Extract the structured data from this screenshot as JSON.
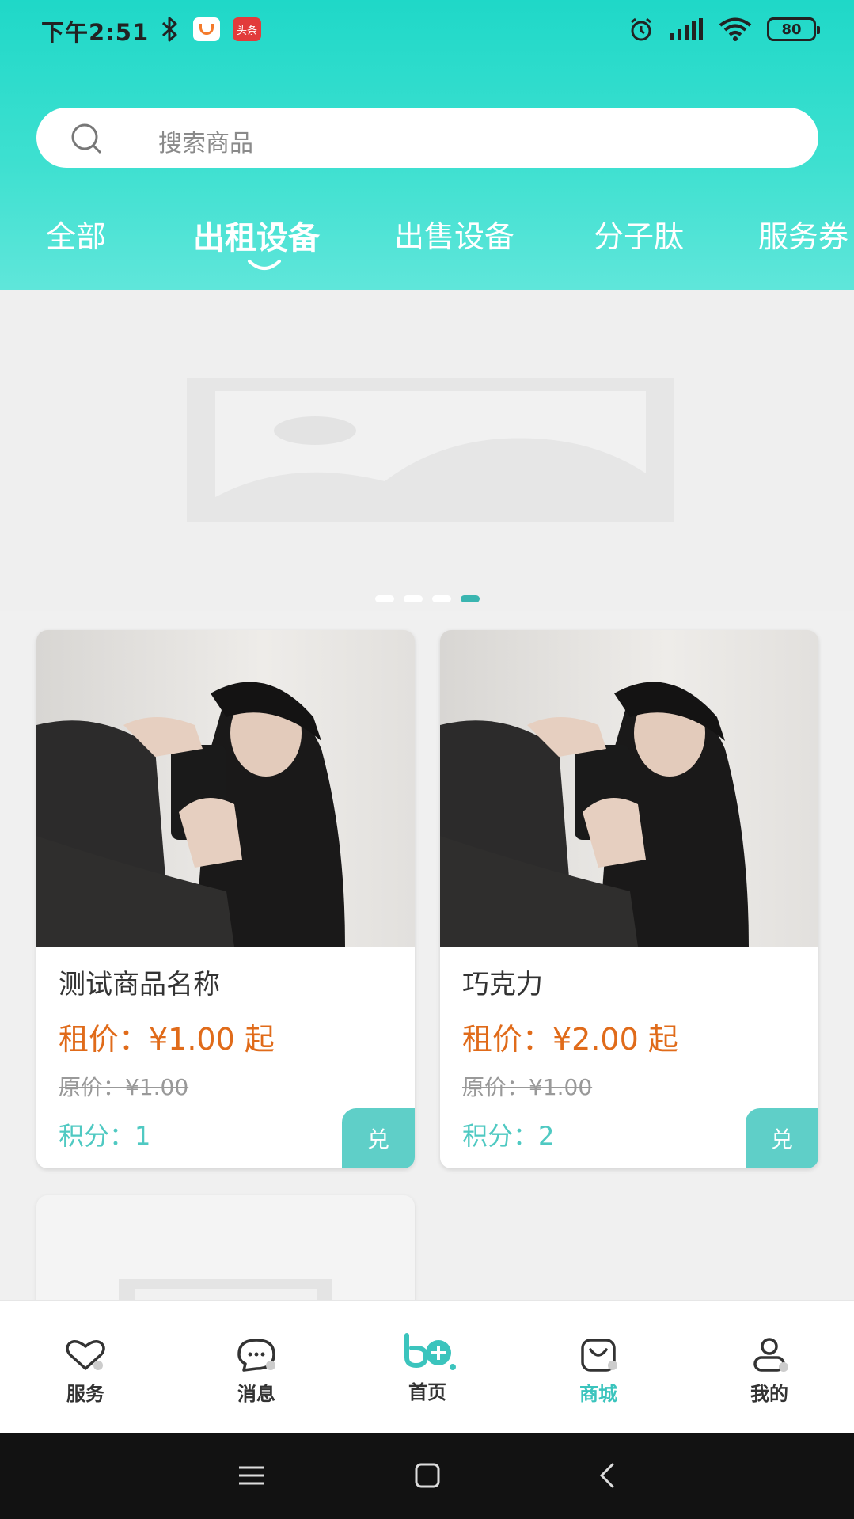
{
  "status_bar": {
    "time": "下午2:51",
    "app_badge_2": "头条",
    "battery": "80"
  },
  "search": {
    "placeholder": "搜索商品"
  },
  "tabs": [
    {
      "label": "全部"
    },
    {
      "label": "出租设备",
      "active": true
    },
    {
      "label": "出售设备"
    },
    {
      "label": "分子肽"
    },
    {
      "label": "服务券"
    }
  ],
  "banner": {
    "slide_count": 4,
    "active_index": 3
  },
  "products": [
    {
      "name": "测试商品名称",
      "price": "租价：¥1.00 起",
      "original_price": "原价：¥1.00",
      "points": "积分：1",
      "exchange_label": "兑"
    },
    {
      "name": "巧克力",
      "price": "租价：¥2.00 起",
      "original_price": "原价：¥1.00",
      "points": "积分：2",
      "exchange_label": "兑"
    }
  ],
  "bottom_nav": [
    {
      "label": "服务",
      "icon": "heart-icon"
    },
    {
      "label": "消息",
      "icon": "chat-icon"
    },
    {
      "label": "首页",
      "icon": "home-logo-icon"
    },
    {
      "label": "商城",
      "icon": "shopping-bag-icon",
      "active": true
    },
    {
      "label": "我的",
      "icon": "user-icon"
    }
  ],
  "colors": {
    "header_accent": "#1fd8c8",
    "price": "#e06b1a",
    "points": "#4fc9c2",
    "active_nav": "#3bc4bd"
  }
}
